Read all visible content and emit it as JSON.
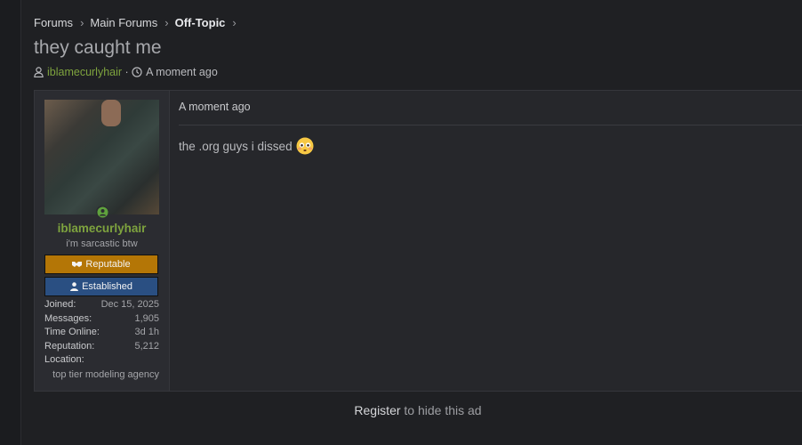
{
  "breadcrumb": {
    "items": [
      "Forums",
      "Main Forums",
      "Off-Topic"
    ]
  },
  "thread": {
    "title": "they caught me",
    "author": "iblamecurlyhair",
    "time": "A moment ago"
  },
  "post": {
    "user": {
      "name": "iblamecurlyhair",
      "title": "i'm sarcastic btw",
      "online": true,
      "badges": [
        {
          "label": "Reputable",
          "color": "#b47606"
        },
        {
          "label": "Established",
          "color": "#2a4f82"
        }
      ],
      "stats": [
        {
          "label": "Joined:",
          "value": "Dec 15, 2025"
        },
        {
          "label": "Messages:",
          "value": "1,905"
        },
        {
          "label": "Time Online:",
          "value": "3d 1h"
        },
        {
          "label": "Reputation:",
          "value": "5,212"
        }
      ],
      "location_label": "Location:",
      "location_value": "top tier modeling agency"
    },
    "time": "A moment ago",
    "content": "the .org guys i dissed",
    "emoji": "flushed-face-emoji"
  },
  "ad": {
    "link": "Register",
    "text": " to hide this ad"
  },
  "colors": {
    "accent": "#7ea33e",
    "background": "#1f2023"
  }
}
